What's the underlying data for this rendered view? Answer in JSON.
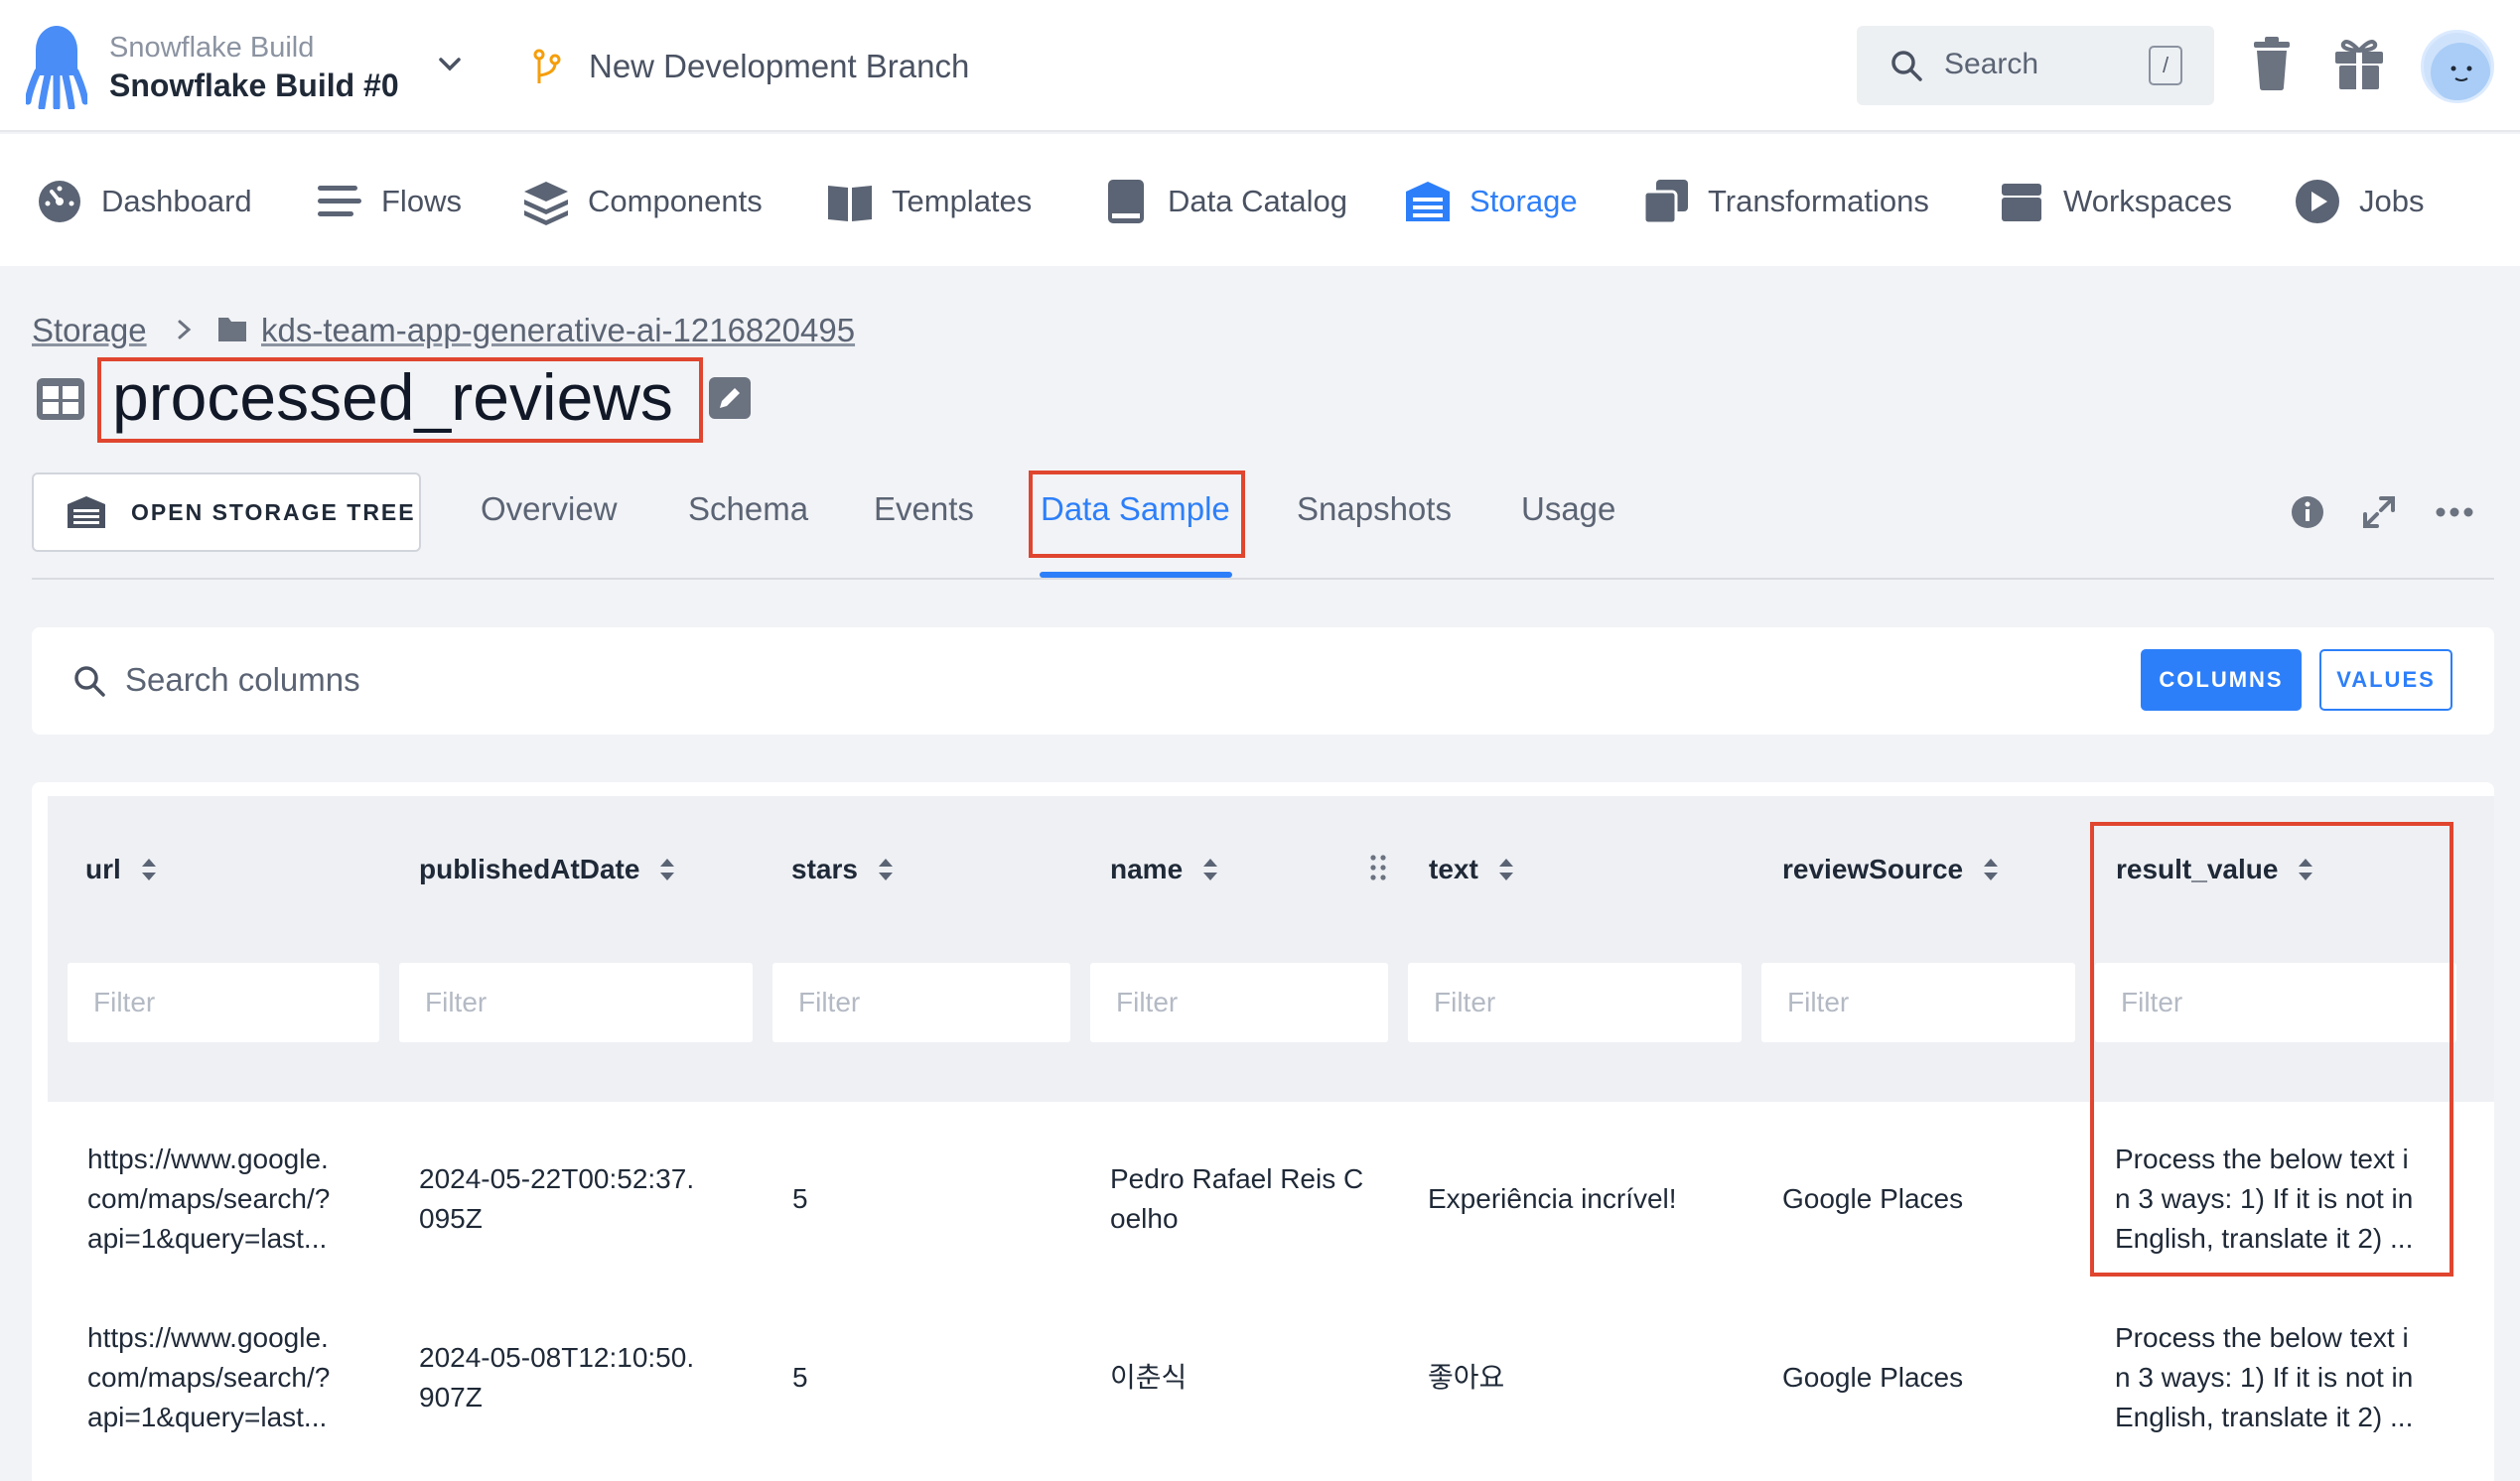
{
  "project": {
    "subtitle": "Snowflake Build",
    "name": "Snowflake Build #0"
  },
  "branch": {
    "name": "New Development Branch"
  },
  "search": {
    "placeholder": "Search",
    "shortcut": "/"
  },
  "nav": [
    {
      "label": "Dashboard",
      "icon": "dashboard-icon"
    },
    {
      "label": "Flows",
      "icon": "flows-icon"
    },
    {
      "label": "Components",
      "icon": "components-icon"
    },
    {
      "label": "Templates",
      "icon": "templates-icon"
    },
    {
      "label": "Data Catalog",
      "icon": "data-catalog-icon"
    },
    {
      "label": "Storage",
      "icon": "storage-icon",
      "active": true
    },
    {
      "label": "Transformations",
      "icon": "transformations-icon"
    },
    {
      "label": "Workspaces",
      "icon": "workspaces-icon"
    },
    {
      "label": "Jobs",
      "icon": "jobs-icon"
    }
  ],
  "breadcrumb": {
    "root": "Storage",
    "bucket": "kds-team-app-generative-ai-1216820495"
  },
  "page": {
    "title": "processed_reviews"
  },
  "toolbar": {
    "open_storage_tree": "OPEN STORAGE TREE"
  },
  "tabs": [
    {
      "label": "Overview"
    },
    {
      "label": "Schema"
    },
    {
      "label": "Events"
    },
    {
      "label": "Data Sample",
      "active": true
    },
    {
      "label": "Snapshots"
    },
    {
      "label": "Usage"
    }
  ],
  "data_sample": {
    "search_placeholder": "Search columns",
    "columns_button": "COLUMNS",
    "values_button": "VALUES",
    "filter_placeholder": "Filter",
    "columns": [
      "url",
      "publishedAtDate",
      "stars",
      "name",
      "text",
      "reviewSource",
      "result_value"
    ],
    "rows": [
      {
        "url": [
          "https://www.google.",
          "com/maps/search/?",
          "api=1&query=last..."
        ],
        "publishedAtDate": [
          "2024-05-22T00:52:37.",
          "095Z"
        ],
        "stars": "5",
        "name": [
          "Pedro Rafael Reis C",
          "oelho"
        ],
        "text": "Experiência incrível!",
        "reviewSource": "Google Places",
        "result_value": [
          "Process the below text i",
          "n 3 ways: 1) If it is not in",
          "English, translate it 2) ..."
        ]
      },
      {
        "url": [
          "https://www.google.",
          "com/maps/search/?",
          "api=1&query=last..."
        ],
        "publishedAtDate": [
          "2024-05-08T12:10:50.",
          "907Z"
        ],
        "stars": "5",
        "name": [
          "이춘식"
        ],
        "text": "좋아요",
        "reviewSource": "Google Places",
        "result_value": [
          "Process the below text i",
          "n 3 ways: 1) If it is not in",
          "English, translate it 2) ..."
        ]
      }
    ]
  },
  "colors": {
    "accent": "#2d7ff9",
    "highlight": "#e0452f",
    "brand": "#4a8df6"
  }
}
